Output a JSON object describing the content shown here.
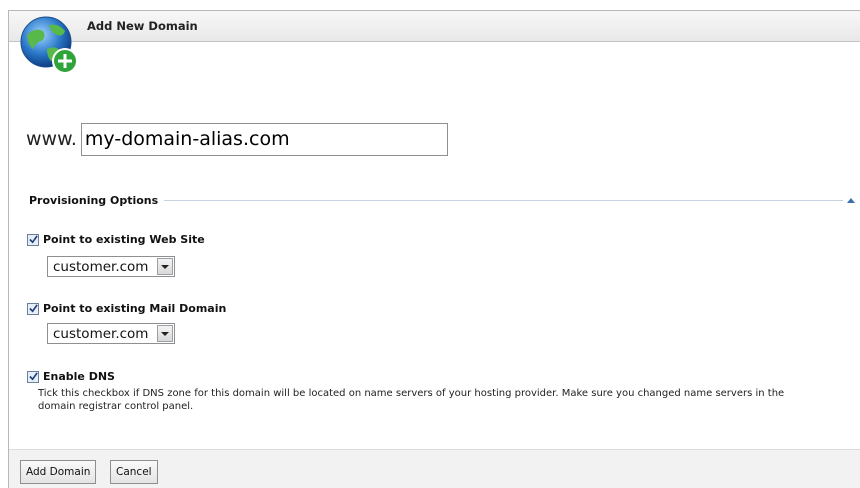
{
  "header": {
    "title": "Add New Domain",
    "icon": "globe-add-icon"
  },
  "domain": {
    "prefix": "www.",
    "value": "my-domain-alias.com"
  },
  "provisioning": {
    "title": "Provisioning Options",
    "collapse_icon": "collapse-up-icon"
  },
  "options": {
    "web_site": {
      "label": "Point to existing Web Site",
      "checked": true,
      "selected": "customer.com"
    },
    "mail_domain": {
      "label": "Point to existing Mail Domain",
      "checked": true,
      "selected": "customer.com"
    },
    "dns": {
      "label": "Enable DNS",
      "checked": true,
      "help": "Tick this checkbox if DNS zone for this domain will be located on name servers of your hosting provider. Make sure you changed name servers in the domain registrar control panel."
    }
  },
  "footer": {
    "add_label": "Add Domain",
    "cancel_label": "Cancel"
  },
  "colors": {
    "accent_line": "#c7d3e3",
    "globe_plus": "#2fa43a"
  }
}
